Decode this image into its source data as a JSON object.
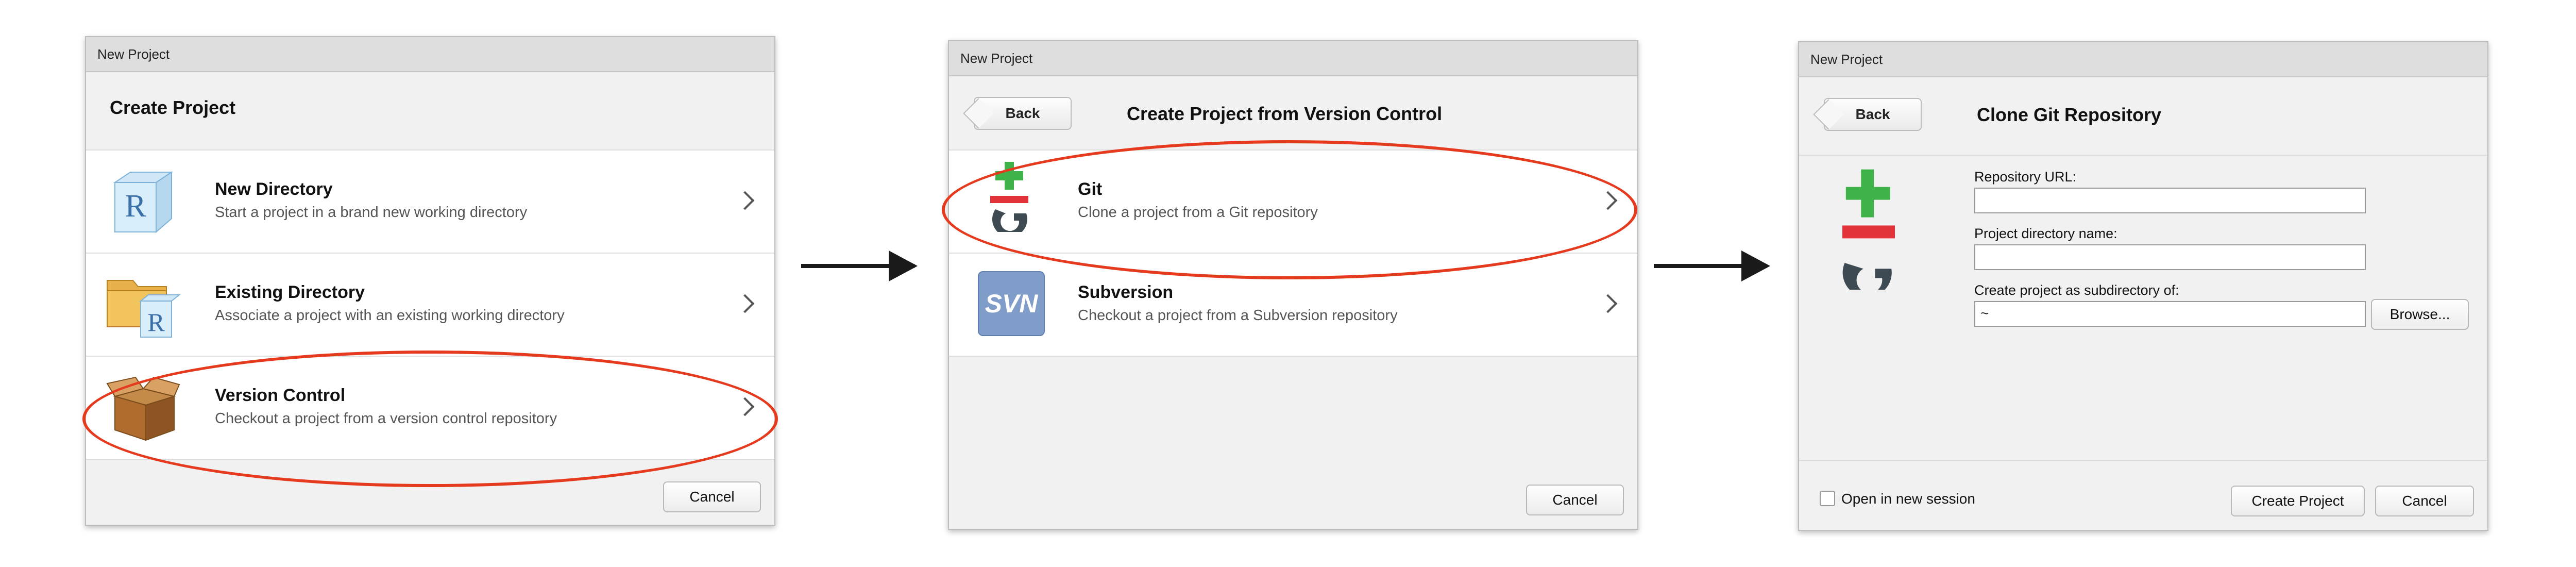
{
  "dialog1": {
    "window_title": "New Project",
    "header_title": "Create Project",
    "items": [
      {
        "title": "New Directory",
        "desc": "Start a project in a brand new working directory"
      },
      {
        "title": "Existing Directory",
        "desc": "Associate a project with an existing working directory"
      },
      {
        "title": "Version Control",
        "desc": "Checkout a project from a version control repository"
      }
    ],
    "cancel_label": "Cancel"
  },
  "dialog2": {
    "window_title": "New Project",
    "back_label": "Back",
    "header_title": "Create Project from Version Control",
    "items": [
      {
        "title": "Git",
        "desc": "Clone a project from a Git repository"
      },
      {
        "title": "Subversion",
        "desc": "Checkout a project from a Subversion repository"
      }
    ],
    "svn_icon_text": "SVN",
    "cancel_label": "Cancel"
  },
  "dialog3": {
    "window_title": "New Project",
    "back_label": "Back",
    "header_title": "Clone Git Repository",
    "repo_url_label": "Repository URL:",
    "repo_url_value": "",
    "dir_name_label": "Project directory name:",
    "dir_name_value": "",
    "subdir_label": "Create project as subdirectory of:",
    "subdir_value": "~",
    "browse_label": "Browse...",
    "open_new_session_label": "Open in new session",
    "open_new_session_checked": false,
    "create_label": "Create Project",
    "cancel_label": "Cancel"
  },
  "icons": {
    "r_letter": "R",
    "git_icon_name": "git-icon",
    "svn_icon_name": "svn-icon"
  },
  "colors": {
    "highlight_ellipse": "#e53a1e",
    "git_green": "#3fb24a",
    "git_red": "#e2323a",
    "git_dark": "#3e4a52",
    "svn_blue": "#809cc9"
  }
}
